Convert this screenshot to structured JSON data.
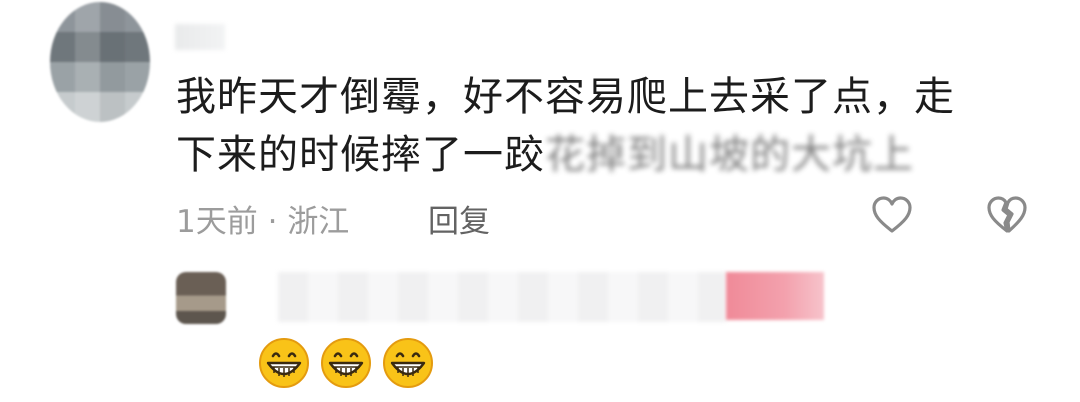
{
  "comment": {
    "line1": "我昨天才倒霉，好不容易爬上去采了点，走",
    "line2_visible": "下来的时候摔了一跤",
    "line2_blurred": "花掉到山坡的大坑上",
    "time": "1天前",
    "separator": "·",
    "location": "浙江",
    "reply_label": "回复"
  },
  "icons": {
    "like": "heart-outline-icon",
    "dislike": "broken-heart-icon",
    "emoji": "grinning-face-icon"
  },
  "reply_thread": {
    "emoji_count": 3
  },
  "colors": {
    "text": "#1c1c1c",
    "meta": "#9c9c9c",
    "icon": "#8a8a8a",
    "emoji_yellow": "#f9c318"
  }
}
